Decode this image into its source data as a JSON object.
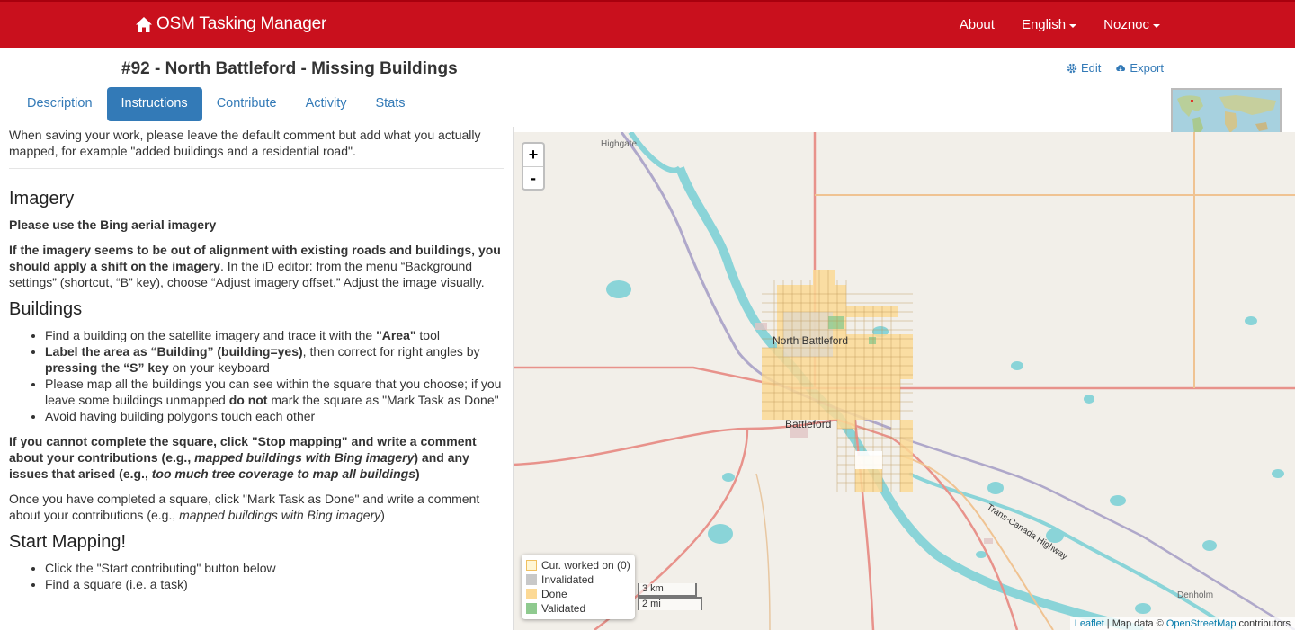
{
  "navbar": {
    "brand": "OSM Tasking Manager",
    "links": [
      "About",
      "English",
      "Noznoc"
    ]
  },
  "project": {
    "title": "#92 - North Battleford - Missing Buildings",
    "actions": [
      "Edit",
      "Export"
    ]
  },
  "tabs": [
    "Description",
    "Instructions",
    "Contribute",
    "Activity",
    "Stats"
  ],
  "active_tab": "Instructions",
  "instructions": {
    "intro": "When saving your work, please leave the default comment but add what you actually mapped, for example \"added buildings and a residential road\".",
    "imagery_heading": "Imagery",
    "imagery_p1": "Please use the Bing aerial imagery",
    "imagery_p2_bold": "If the imagery seems to be out of alignment with existing roads and buildings, you should apply a shift on the imagery",
    "imagery_p2_rest": ". In the iD editor: from the menu “Background settings” (shortcut, “B” key), choose “Adjust imagery offset.” Adjust the image visually.",
    "buildings_heading": "Buildings",
    "b1_pre": "Find a building on the satellite imagery and trace it with the ",
    "b1_bold": "\"Area\"",
    "b1_post": " tool",
    "b2_bold1": "Label the area as “Building” (building=yes)",
    "b2_mid": ", then correct for right angles by ",
    "b2_bold2": "pressing the “S” key",
    "b2_post": " on your keyboard",
    "b3_pre": "Please map all the buildings you can see within the square that you choose; if you leave some buildings unmapped ",
    "b3_bold": "do not",
    "b3_post": " mark the square as \"Mark Task as Done\"",
    "b4": "Avoid having building polygons touch each other",
    "stop_pre": "If you cannot complete the square, click \"Stop mapping\" and write a comment about your contributions (e.g., ",
    "stop_em1": "mapped buildings with Bing imagery",
    "stop_mid": ") and any issues that arised (e.g., ",
    "stop_em2": "too much tree coverage to map all buildings",
    "stop_post": ")",
    "done_pre": "Once you have completed a square, click \"Mark Task as Done\" and write a comment about your contributions (e.g., ",
    "done_em": "mapped buildings with Bing imagery",
    "done_post": ")",
    "start_heading": "Start Mapping!",
    "s1": "Click the \"Start contributing\" button below",
    "s2": "Find a square (i.e. a task)"
  },
  "map": {
    "zoom_in": "+",
    "zoom_out": "-",
    "labels": {
      "highgate": "Highgate",
      "north_battleford": "North Battleford",
      "battleford": "Battleford",
      "highway": "Trans-Canada Highway",
      "denholm": "Denholm"
    },
    "legend": [
      {
        "label": "Cur. worked on (0)",
        "color": "#fff6d5",
        "border": "#f0c060"
      },
      {
        "label": "Invalidated",
        "color": "#c8c8c8",
        "border": "#c8c8c8"
      },
      {
        "label": "Done",
        "color": "#fcd995",
        "border": "#fcd995"
      },
      {
        "label": "Validated",
        "color": "#8fca8f",
        "border": "#8fca8f"
      }
    ],
    "scale_metric": "3 km",
    "scale_imperial": "2 mi",
    "attribution_leaflet": "Leaflet",
    "attribution_mid": " | Map data © ",
    "attribution_osm": "OpenStreetMap",
    "attribution_post": " contributors"
  }
}
